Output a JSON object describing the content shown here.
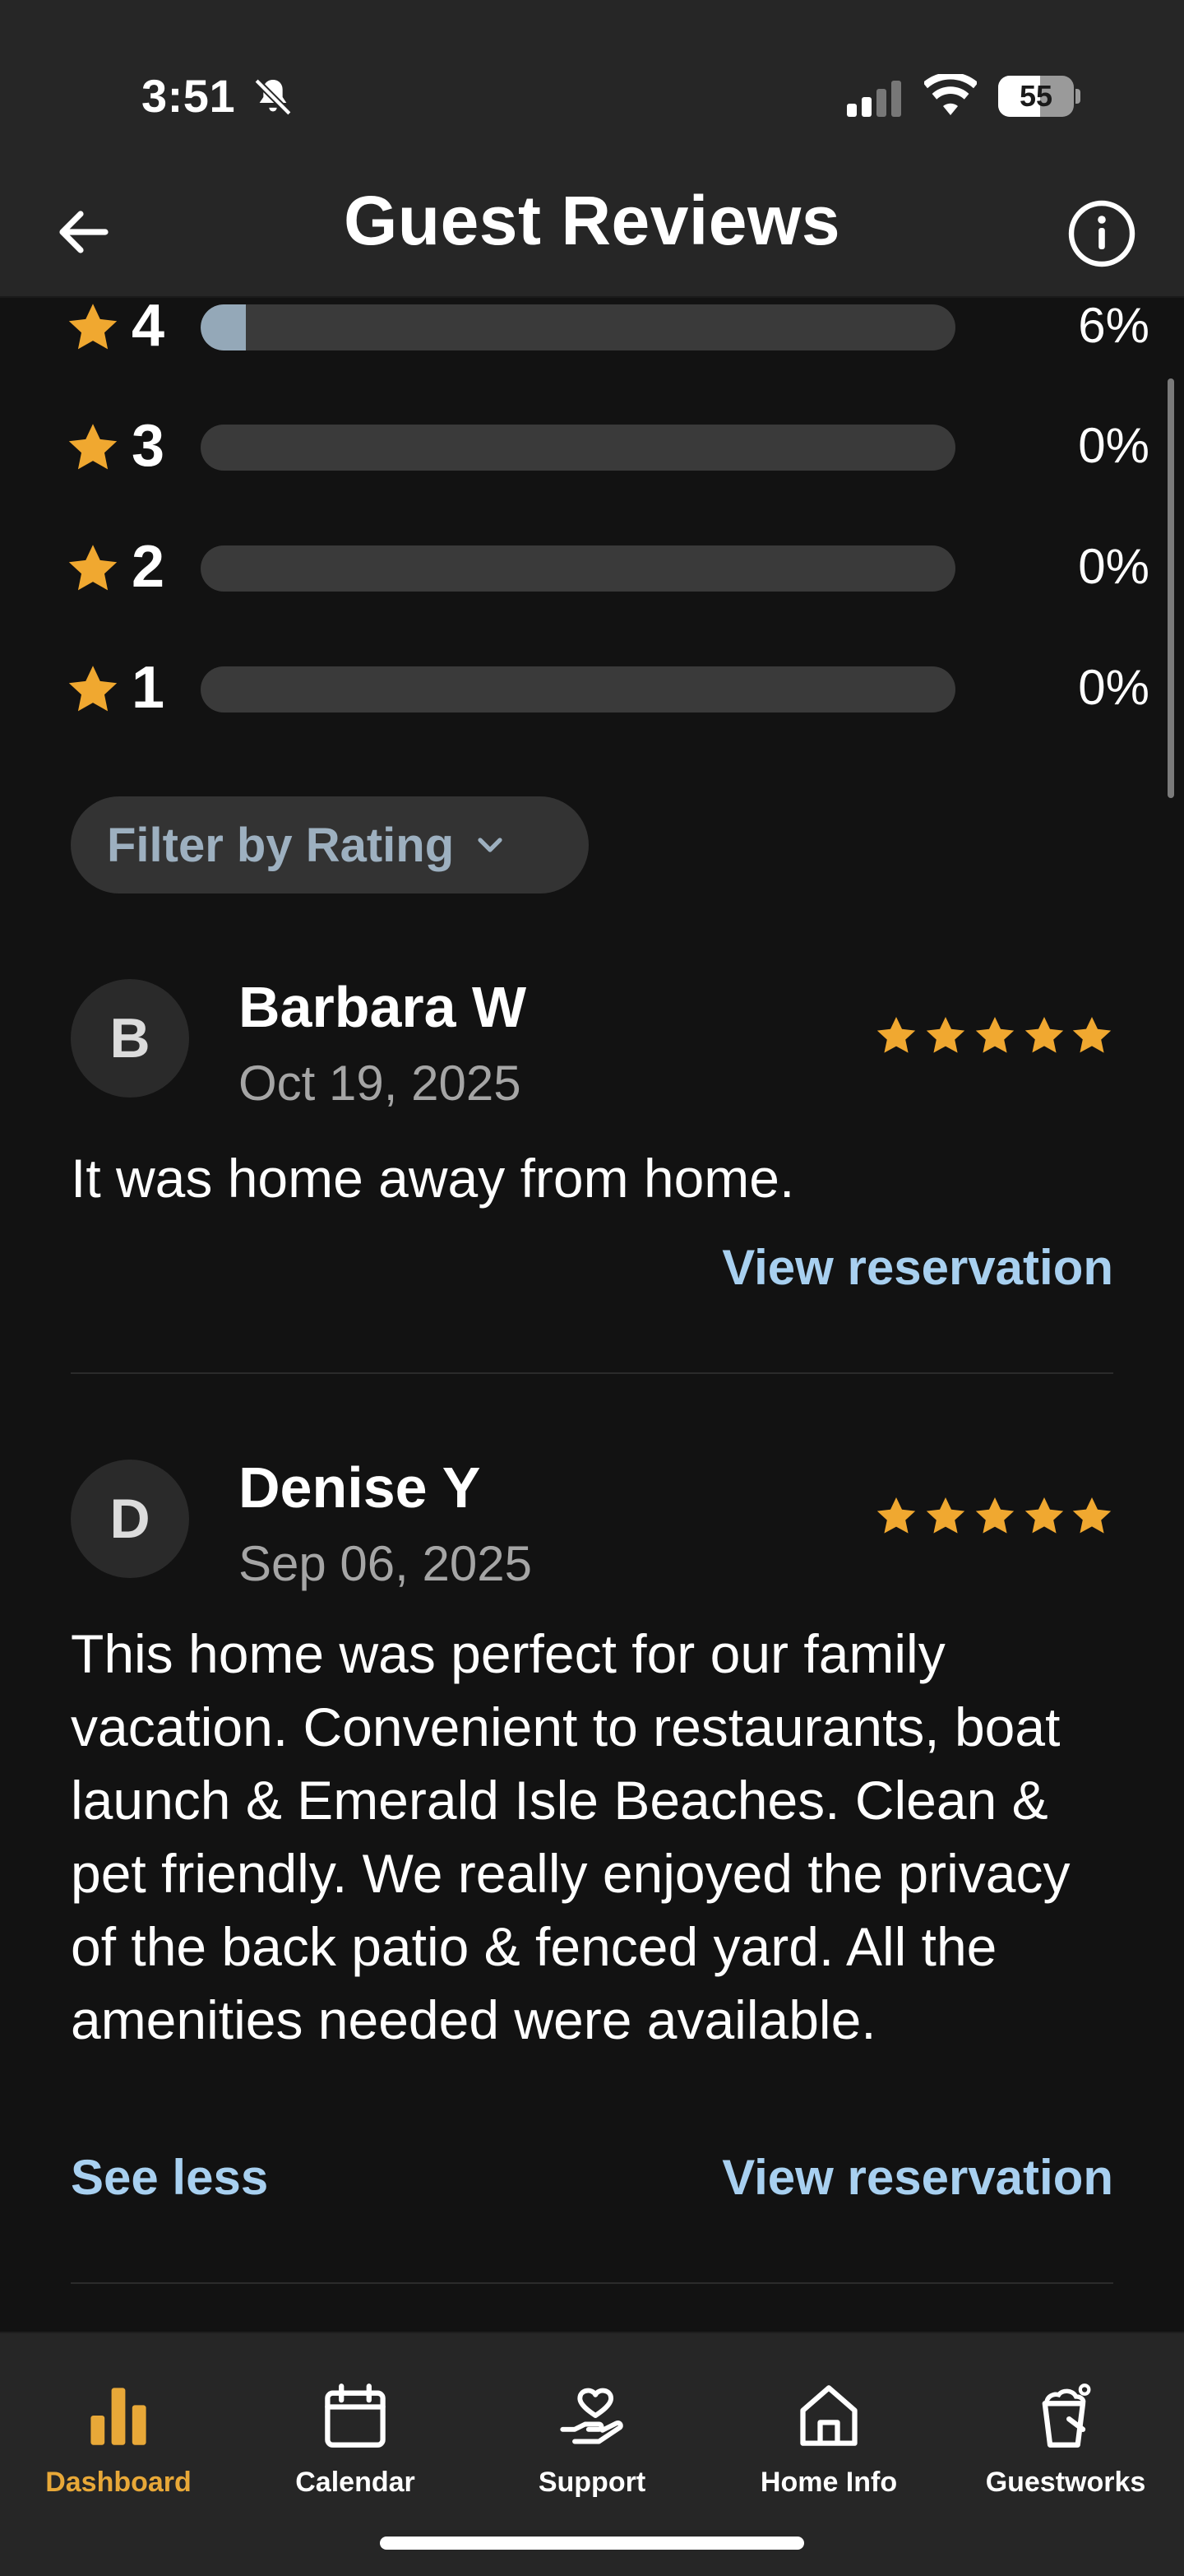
{
  "status_bar": {
    "time": "3:51",
    "battery": "55",
    "battery_level": 0.55
  },
  "header": {
    "title": "Guest Reviews"
  },
  "rating_distribution": [
    {
      "stars": "4",
      "percent_label": "6%",
      "fraction": 0.06
    },
    {
      "stars": "3",
      "percent_label": "0%",
      "fraction": 0
    },
    {
      "stars": "2",
      "percent_label": "0%",
      "fraction": 0
    },
    {
      "stars": "1",
      "percent_label": "0%",
      "fraction": 0
    }
  ],
  "filter": {
    "label": "Filter by Rating"
  },
  "reviews": [
    {
      "initial": "B",
      "name": "Barbara W",
      "date": "Oct 19, 2025",
      "rating": 5,
      "text": "It was home away from home.",
      "view_label": "View reservation"
    },
    {
      "initial": "D",
      "name": "Denise Y",
      "date": "Sep 06, 2025",
      "rating": 5,
      "text": "This home was perfect for our family vacation. Convenient to restaurants, boat launch & Emerald Isle Beaches. Clean & pet friendly. We really enjoyed the privacy of the back patio & fenced yard. All the amenities needed were available.",
      "see_less_label": "See less",
      "view_label": "View reservation"
    }
  ],
  "tabbar": {
    "items": [
      {
        "label": "Dashboard",
        "icon": "bar-chart-icon",
        "active": true
      },
      {
        "label": "Calendar",
        "icon": "calendar-icon",
        "active": false
      },
      {
        "label": "Support",
        "icon": "support-hand-icon",
        "active": false
      },
      {
        "label": "Home Info",
        "icon": "home-icon",
        "active": false
      },
      {
        "label": "Guestworks",
        "icon": "bucket-icon",
        "active": false
      }
    ]
  },
  "colors": {
    "accent": "#e8a838",
    "link": "#a8d0f0",
    "star": "#f0a830",
    "bar_fill": "#94a8b8",
    "background": "#121212"
  }
}
